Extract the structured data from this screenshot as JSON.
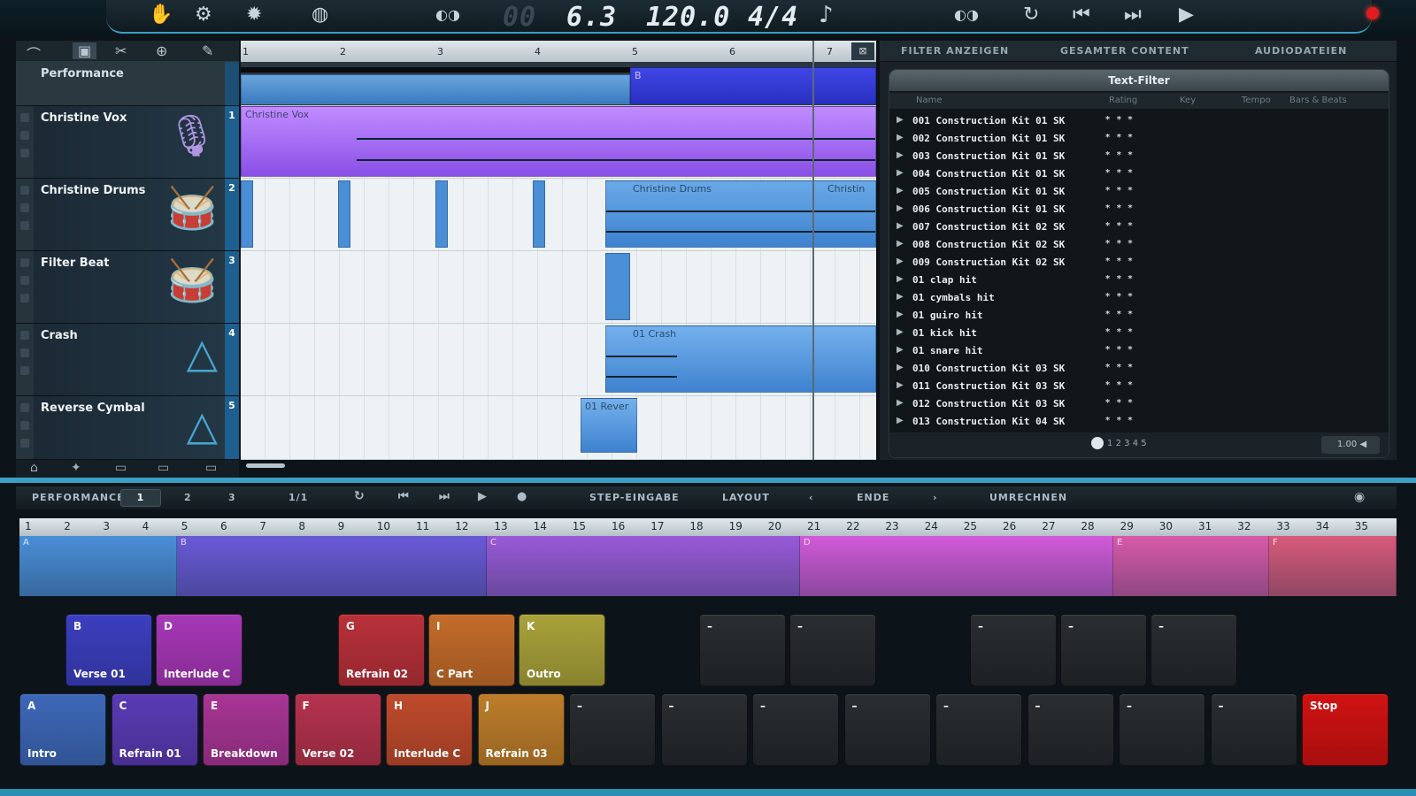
{
  "transport": {
    "position": "6.3",
    "position_dim": "00",
    "tempo": "120.0",
    "signature": "4/4",
    "note_icon": "eighth-note-icon"
  },
  "upper_ruler": [
    "1",
    "2",
    "3",
    "4",
    "5",
    "6",
    "7"
  ],
  "tracks": [
    {
      "name": "Performance",
      "num": ""
    },
    {
      "name": "Christine Vox",
      "num": "1"
    },
    {
      "name": "Christine Drums",
      "num": "2"
    },
    {
      "name": "Filter Beat",
      "num": "3"
    },
    {
      "name": "Crash",
      "num": "4"
    },
    {
      "name": "Reverse Cymbal",
      "num": "5"
    }
  ],
  "clips": {
    "perf_marker": "B",
    "vox": "Christine Vox",
    "drums": "Christine Drums",
    "drums2": "Christin",
    "crash": "01 Crash",
    "reverse": "01 Rever"
  },
  "browser": {
    "tabs": [
      "FILTER ANZEIGEN",
      "GESAMTER CONTENT",
      "AUDIODATEIEN"
    ],
    "filter_title": "Text-Filter",
    "columns": [
      "Name",
      "Rating",
      "Key",
      "Tempo",
      "Bars & Beats"
    ],
    "rows": [
      "001 Construction Kit 01 SK",
      "002 Construction Kit 01 SK",
      "003 Construction Kit 01 SK",
      "004 Construction Kit 01 SK",
      "005 Construction Kit 01 SK",
      "006 Construction Kit 01 SK",
      "007 Construction Kit 02 SK",
      "008 Construction Kit 02 SK",
      "009 Construction Kit 02 SK",
      "01 clap hit",
      "01 cymbals hit",
      "01 guiro hit",
      "01 kick hit",
      "01 snare hit",
      "010 Construction Kit 03 SK",
      "011 Construction Kit 03 SK",
      "012 Construction Kit 03 SK",
      "013 Construction Kit 04 SK"
    ],
    "rating": "* * *",
    "pages": [
      "1",
      "2",
      "3",
      "4",
      "5"
    ],
    "volume": "1.00"
  },
  "perf_toolbar": {
    "label": "PERFORMANCE",
    "p1": "1",
    "p2": "2",
    "p3": "3",
    "quant": "1/1",
    "step": "STEP-EINGABE",
    "layout": "LAYOUT",
    "end": "ENDE",
    "convert": "UMRECHNEN"
  },
  "lower_ruler": [
    "1",
    "2",
    "3",
    "4",
    "5",
    "6",
    "7",
    "8",
    "9",
    "10",
    "11",
    "12",
    "13",
    "14",
    "15",
    "16",
    "17",
    "18",
    "19",
    "20",
    "21",
    "22",
    "23",
    "24",
    "25",
    "26",
    "27",
    "28",
    "29",
    "30",
    "31",
    "32",
    "33",
    "34",
    "35"
  ],
  "segments": [
    {
      "key": "A",
      "color": "#4a8fd8"
    },
    {
      "key": "B",
      "color": "#6a5ad8"
    },
    {
      "key": "C",
      "color": "#9a5ad8"
    },
    {
      "key": "D",
      "color": "#d25ad8"
    },
    {
      "key": "E",
      "color": "#d85aa8"
    },
    {
      "key": "F",
      "color": "#d85a7a"
    }
  ],
  "pads_top": [
    {
      "key": "B",
      "label": "Verse 01",
      "color": "#3c3fbf"
    },
    {
      "key": "D",
      "label": "Interlude C",
      "color": "#a738b7"
    },
    {
      "key": "G",
      "label": "Refrain 02",
      "color": "#b9313a"
    },
    {
      "key": "I",
      "label": "C Part",
      "color": "#c46c2a"
    },
    {
      "key": "K",
      "label": "Outro",
      "color": "#a9a23a"
    },
    {
      "key": "–",
      "label": "",
      "color": ""
    },
    {
      "key": "–",
      "label": "",
      "color": ""
    },
    {
      "key": "–",
      "label": "",
      "color": ""
    },
    {
      "key": "–",
      "label": "",
      "color": ""
    },
    {
      "key": "–",
      "label": "",
      "color": ""
    }
  ],
  "pads_bottom": [
    {
      "key": "A",
      "label": "Intro",
      "color": "#3d68b8"
    },
    {
      "key": "C",
      "label": "Refrain 01",
      "color": "#5a3bb5"
    },
    {
      "key": "E",
      "label": "Breakdown",
      "color": "#a83595"
    },
    {
      "key": "F",
      "label": "Verse 02",
      "color": "#b5334d"
    },
    {
      "key": "H",
      "label": "Interlude C",
      "color": "#bf4b2c"
    },
    {
      "key": "J",
      "label": "Refrain 03",
      "color": "#bd7d2a"
    },
    {
      "key": "–",
      "label": "",
      "color": ""
    },
    {
      "key": "–",
      "label": "",
      "color": ""
    },
    {
      "key": "–",
      "label": "",
      "color": ""
    },
    {
      "key": "–",
      "label": "",
      "color": ""
    },
    {
      "key": "–",
      "label": "",
      "color": ""
    },
    {
      "key": "–",
      "label": "",
      "color": ""
    },
    {
      "key": "–",
      "label": "",
      "color": ""
    },
    {
      "key": "–",
      "label": "",
      "color": ""
    },
    {
      "key": "Stop",
      "label": "",
      "color": "#d01212"
    }
  ]
}
